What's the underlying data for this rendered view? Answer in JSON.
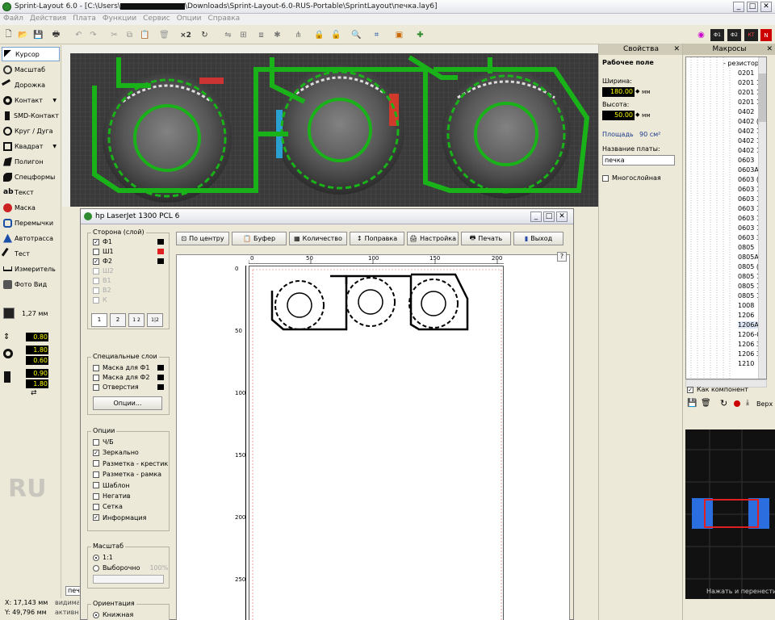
{
  "window": {
    "title": "Sprint-Layout 6.0 - [C:\\Users\\",
    "title_path": "\\Downloads\\Sprint-Layout-6.0-RUS-Portable\\SprintLayout\\печка.lay6]",
    "minimize": "_",
    "maximize": "□",
    "close": "✕"
  },
  "menu": [
    "Файл",
    "Действия",
    "Плата",
    "Функции",
    "Сервис",
    "Опции",
    "Справка"
  ],
  "toolbar": {
    "x2": "×2"
  },
  "tools": [
    {
      "label": "Курсор",
      "icon": "cursor-icon",
      "active": true
    },
    {
      "label": "Масштаб",
      "icon": "zoom-icon"
    },
    {
      "label": "Дорожка",
      "icon": "track-icon"
    },
    {
      "label": "Контакт",
      "icon": "pad-icon"
    },
    {
      "label": "SMD-Контакт",
      "icon": "smd-pad-icon"
    },
    {
      "label": "Круг / Дуга",
      "icon": "circle-arc-icon"
    },
    {
      "label": "Квадрат",
      "icon": "square-icon"
    },
    {
      "label": "Полигон",
      "icon": "polygon-icon"
    },
    {
      "label": "Спецформы",
      "icon": "special-shapes-icon"
    },
    {
      "label": "Текст",
      "icon": "text-icon"
    },
    {
      "label": "Маска",
      "icon": "mask-icon"
    },
    {
      "label": "Перемычки",
      "icon": "jumper-icon"
    },
    {
      "label": "Автотрасса",
      "icon": "autoroute-icon"
    },
    {
      "label": "Тест",
      "icon": "test-icon"
    },
    {
      "label": "Измеритель",
      "icon": "measure-icon"
    },
    {
      "label": "Фото Вид",
      "icon": "photo-view-icon"
    }
  ],
  "grid": {
    "label": "1,27 мм"
  },
  "tool_values": {
    "track_width": "0.80",
    "pad_outer": "1.80",
    "pad_inner": "0.60",
    "smd_w": "0.90",
    "smd_h": "1.80"
  },
  "layer_indicator": "RU",
  "status": {
    "x": "X:  17,143 мм",
    "y": "Y:  49,796 мм",
    "tab": "печ",
    "vis": "видимая",
    "active": "активная"
  },
  "properties": {
    "header": "Свойства",
    "section": "Рабочее поле",
    "width_label": "Ширина:",
    "width_value": "180.00",
    "height_label": "Высота:",
    "height_value": "50.00",
    "unit": "мм",
    "area_label": "Площадь",
    "area_value": "90 см²",
    "board_name_label": "Название платы:",
    "board_name": "печка",
    "multilayer": "Многослойная"
  },
  "macros": {
    "header": "Макросы",
    "category": "- резисторы",
    "items": [
      "0201",
      "0201 1k",
      "0201 1k",
      "0201 1k",
      "0402",
      "0402 (2",
      "0402 1k",
      "0402 1k",
      "0402 12",
      "0603",
      "0603A",
      "0603 (fi",
      "0603 1k",
      "0603 1k",
      "0603 1k",
      "0603 1k",
      "0603 1k",
      "0603 3k",
      "0805",
      "0805A",
      "0805 (2",
      "0805 1k",
      "0805 1k",
      "0805 1k",
      "1008",
      "1206",
      "1206A",
      "1206-0",
      "1206 3k",
      "1206 3k",
      "1210"
    ],
    "as_component": "Как компонент",
    "side": "Верх",
    "hint": "Нажать и перенести"
  },
  "print": {
    "title": "hp LaserJet 1300 PCL 6",
    "buttons": [
      "По центру",
      "Буфер",
      "Количество",
      "Поправка",
      "Настройка",
      "Печать",
      "Выход"
    ],
    "help": "?",
    "side_group": "Сторона (слой)",
    "layers": [
      {
        "label": "Ф1",
        "checked": true,
        "enabled": true,
        "color": "#000000"
      },
      {
        "label": "Ш1",
        "checked": false,
        "enabled": true,
        "color": "#e02020"
      },
      {
        "label": "Ф2",
        "checked": true,
        "enabled": true,
        "color": "#000000"
      },
      {
        "label": "Ш2",
        "checked": false,
        "enabled": false
      },
      {
        "label": "В1",
        "checked": false,
        "enabled": false
      },
      {
        "label": "В2",
        "checked": false,
        "enabled": false
      },
      {
        "label": "К",
        "checked": false,
        "enabled": false
      }
    ],
    "page_icons": [
      "1",
      "2",
      "1 2",
      "1|2"
    ],
    "special_group": "Специальные слои",
    "special": [
      {
        "label": "Маска для Ф1",
        "color": "#000000"
      },
      {
        "label": "Маска для Ф2",
        "color": "#000000"
      },
      {
        "label": "Отверстия",
        "color": "#000000"
      }
    ],
    "options_button": "Опции...",
    "opt_group": "Опции",
    "options": [
      {
        "label": "Ч/Б",
        "checked": false
      },
      {
        "label": "Зеркально",
        "checked": true
      },
      {
        "label": "Разметка - крестик",
        "checked": false
      },
      {
        "label": "Разметка - рамка",
        "checked": false
      },
      {
        "label": "Шаблон",
        "checked": false
      },
      {
        "label": "Негатив",
        "checked": false
      },
      {
        "label": "Сетка",
        "checked": false
      },
      {
        "label": "Информация",
        "checked": true
      }
    ],
    "scale_group": "Масштаб",
    "scale_1": "1:1",
    "scale_sel": "Выборочно",
    "scale_pct": "100%",
    "orient_group": "Ориентация",
    "orient_portrait": "Книжная",
    "ruler_top": [
      "0",
      "50",
      "100",
      "150",
      "200"
    ],
    "ruler_left": [
      "0",
      "50",
      "100",
      "150",
      "200",
      "250"
    ]
  }
}
